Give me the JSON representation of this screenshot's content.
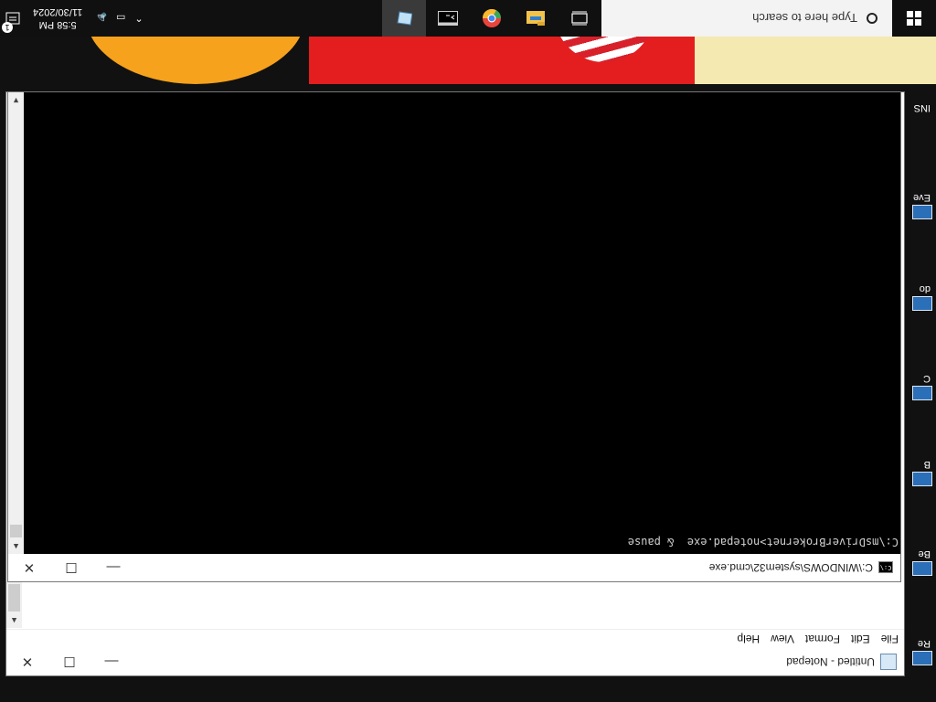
{
  "taskbar": {
    "search_placeholder": "Type here to search",
    "pinned": [
      "task-view-icon",
      "file-explorer-icon",
      "chrome-icon",
      "cmd-icon",
      "notepad-icon"
    ],
    "clock_time": "5:58 PM",
    "clock_date": "11/30/2024",
    "notification_count": "1"
  },
  "desktop": {
    "icon_labels": [
      "Re",
      "Be",
      "B",
      "C",
      "do",
      "Eve",
      "INS"
    ]
  },
  "notepad": {
    "title": "Untitled - Notepad",
    "menu": [
      "File",
      "Edit",
      "Format",
      "View",
      "Help"
    ],
    "content": ""
  },
  "cmd": {
    "title": "C:\\WINDOWS\\system32\\cmd.exe",
    "icon_text": "C:\\",
    "line": "C:\\msDriverBrokernet>notepad.exe  & pause"
  },
  "window_controls": {
    "minimize": "—",
    "maximize": "☐",
    "close": "✕"
  }
}
